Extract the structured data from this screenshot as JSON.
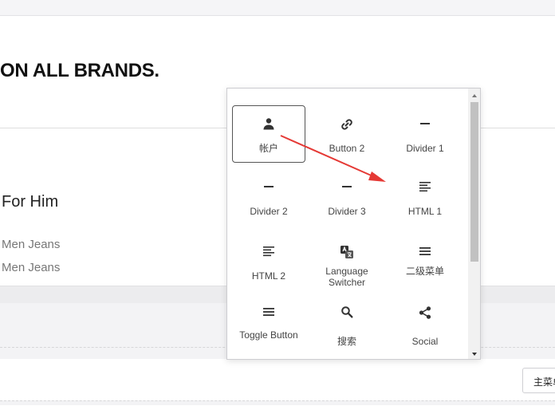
{
  "page": {
    "headline": "ON ALL BRANDS.",
    "heading": "For Him",
    "links": [
      "Men Jeans",
      "Men Jeans"
    ],
    "menu_button": "主菜单"
  },
  "picker": {
    "items": [
      {
        "label": "帐户",
        "icon": "user-icon",
        "selected": true
      },
      {
        "label": "Button 2",
        "icon": "link-icon"
      },
      {
        "label": "Divider 1",
        "icon": "divider-icon"
      },
      {
        "label": "Divider 2",
        "icon": "divider-icon"
      },
      {
        "label": "Divider 3",
        "icon": "divider-icon"
      },
      {
        "label": "HTML 1",
        "icon": "html-icon"
      },
      {
        "label": "HTML 2",
        "icon": "html-icon"
      },
      {
        "label": "Language Switcher",
        "icon": "translate-icon"
      },
      {
        "label": "二级菜单",
        "icon": "menu-icon"
      },
      {
        "label": "Toggle Button",
        "icon": "menu-icon"
      },
      {
        "label": "搜索",
        "icon": "search-icon"
      },
      {
        "label": "Social",
        "icon": "share-icon"
      }
    ]
  },
  "colors": {
    "annotation_arrow": "#e53935"
  }
}
